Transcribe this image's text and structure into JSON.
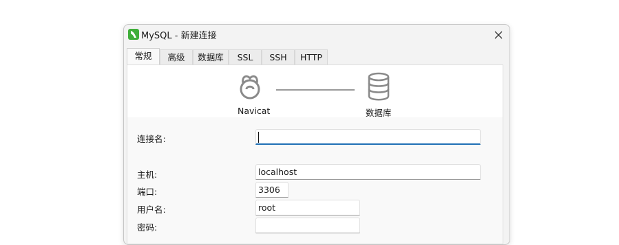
{
  "window": {
    "title": "MySQL - 新建连接"
  },
  "tabs": [
    {
      "label": "常规",
      "active": true
    },
    {
      "label": "高级"
    },
    {
      "label": "数据库"
    },
    {
      "label": "SSL"
    },
    {
      "label": "SSH"
    },
    {
      "label": "HTTP"
    }
  ],
  "diagram": {
    "source_label": "Navicat",
    "target_label": "数据库"
  },
  "form": {
    "connection_name": {
      "label": "连接名:",
      "value": ""
    },
    "host": {
      "label": "主机:",
      "value": "localhost"
    },
    "port": {
      "label": "端口:",
      "value": "3306"
    },
    "username": {
      "label": "用户名:",
      "value": "root"
    },
    "password": {
      "label": "密码:",
      "value": ""
    }
  },
  "colors": {
    "accent": "#1f6fb5",
    "app_icon": "#3fae3a",
    "icon_gray": "#8a8a8a"
  },
  "icons": [
    "navicat-app-icon",
    "close-icon",
    "navicat-logo-icon",
    "database-icon"
  ]
}
